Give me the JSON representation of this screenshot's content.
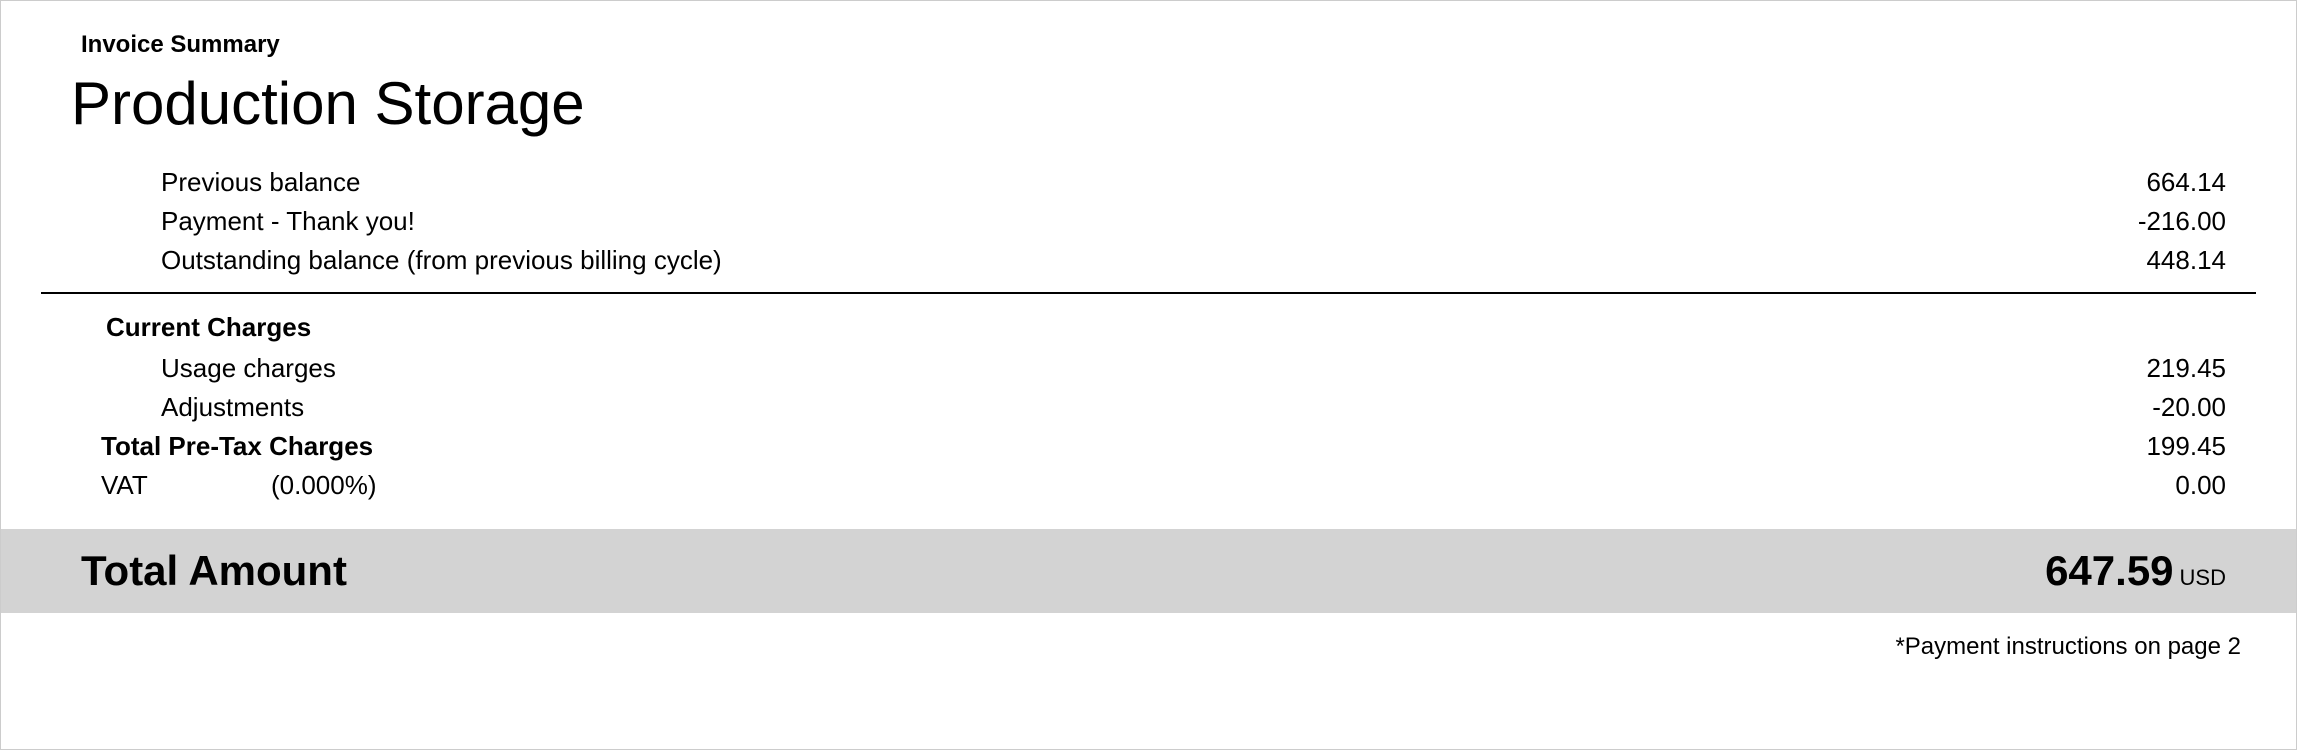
{
  "header": {
    "section_label": "Invoice Summary",
    "title": "Production Storage"
  },
  "previous": {
    "balance_label": "Previous balance",
    "balance_value": "664.14",
    "payment_label": "Payment - Thank you!",
    "payment_value": "-216.00",
    "outstanding_label": "Outstanding balance (from previous billing cycle)",
    "outstanding_value": "448.14"
  },
  "current": {
    "section_label": "Current Charges",
    "usage_label": "Usage charges",
    "usage_value": "219.45",
    "adjustments_label": "Adjustments",
    "adjustments_value": "-20.00"
  },
  "subtotal": {
    "label": "Total Pre-Tax Charges",
    "value": "199.45"
  },
  "vat": {
    "label": "VAT",
    "rate": "(0.000%)",
    "value": "0.00"
  },
  "total": {
    "label": "Total Amount",
    "value": "647.59",
    "currency": "USD"
  },
  "footnote": "*Payment instructions on page 2"
}
